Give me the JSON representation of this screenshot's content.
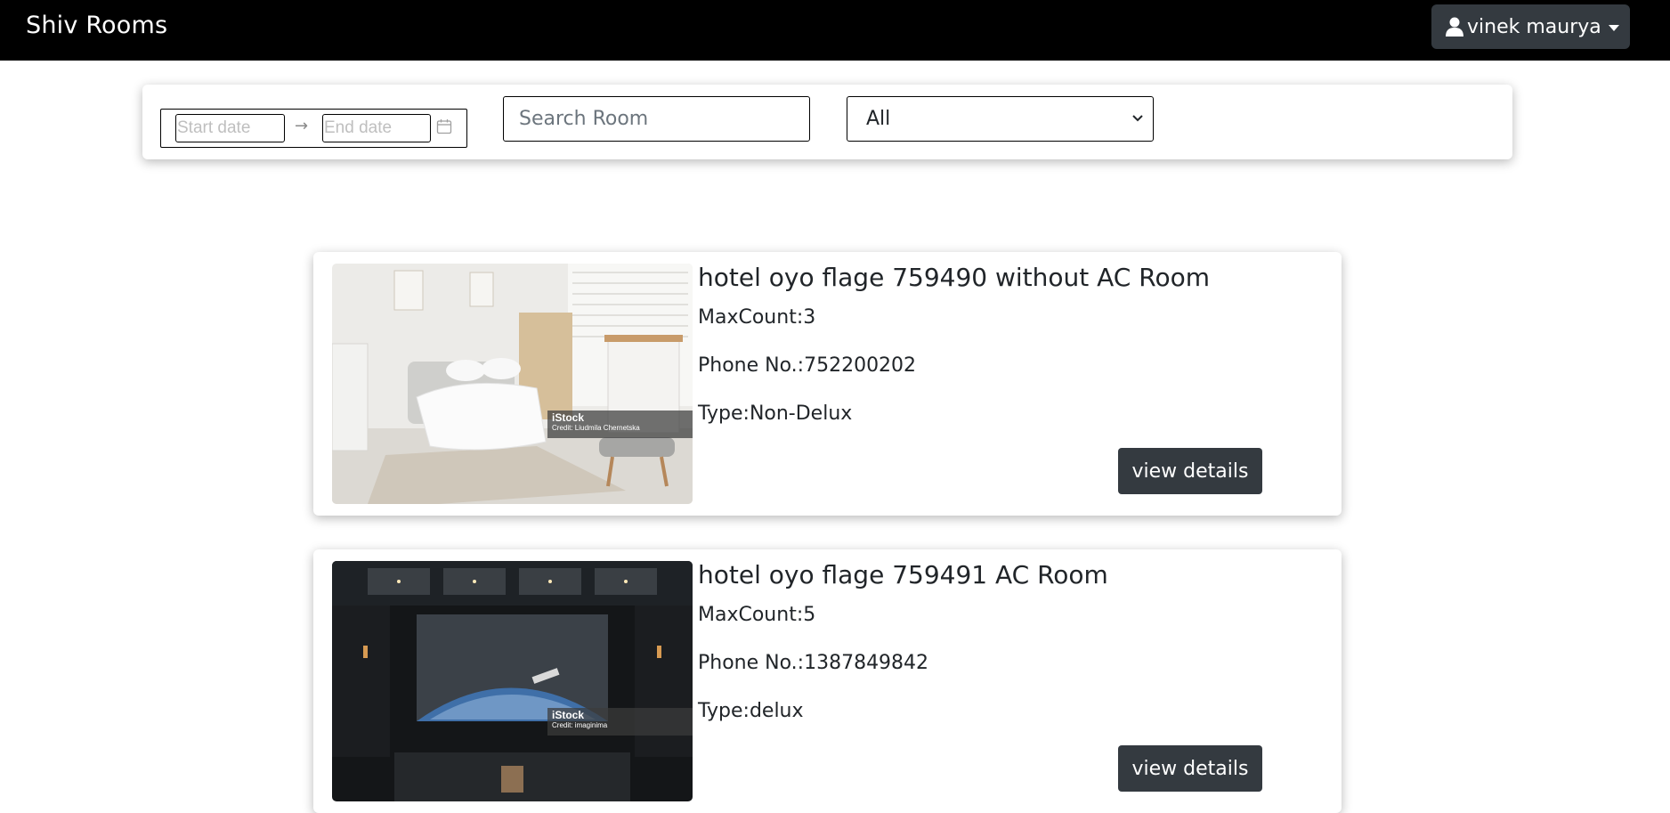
{
  "navbar": {
    "brand": "Shiv Rooms",
    "user_name": "vinek maurya"
  },
  "filters": {
    "start_placeholder": "Start date",
    "end_placeholder": "End date",
    "range_separator": "→",
    "search_placeholder": "Search Room",
    "type_selected": "All"
  },
  "rooms": [
    {
      "name": "hotel oyo flage 759490 without AC Room",
      "max_count": "MaxCount:3",
      "phone": "Phone No.:752200202",
      "type": "Type:Non-Delux",
      "button": "view details",
      "image_brand": "iStock",
      "image_credit": "Credit: Liudmila Chernetska"
    },
    {
      "name": "hotel oyo flage 759491 AC Room",
      "max_count": "MaxCount:5",
      "phone": "Phone No.:1387849842",
      "type": "Type:delux",
      "button": "view details",
      "image_brand": "iStock",
      "image_credit": "Credit: imaginima"
    }
  ],
  "colors": {
    "navbar_bg": "#000000",
    "button_dark": "#343a40"
  }
}
